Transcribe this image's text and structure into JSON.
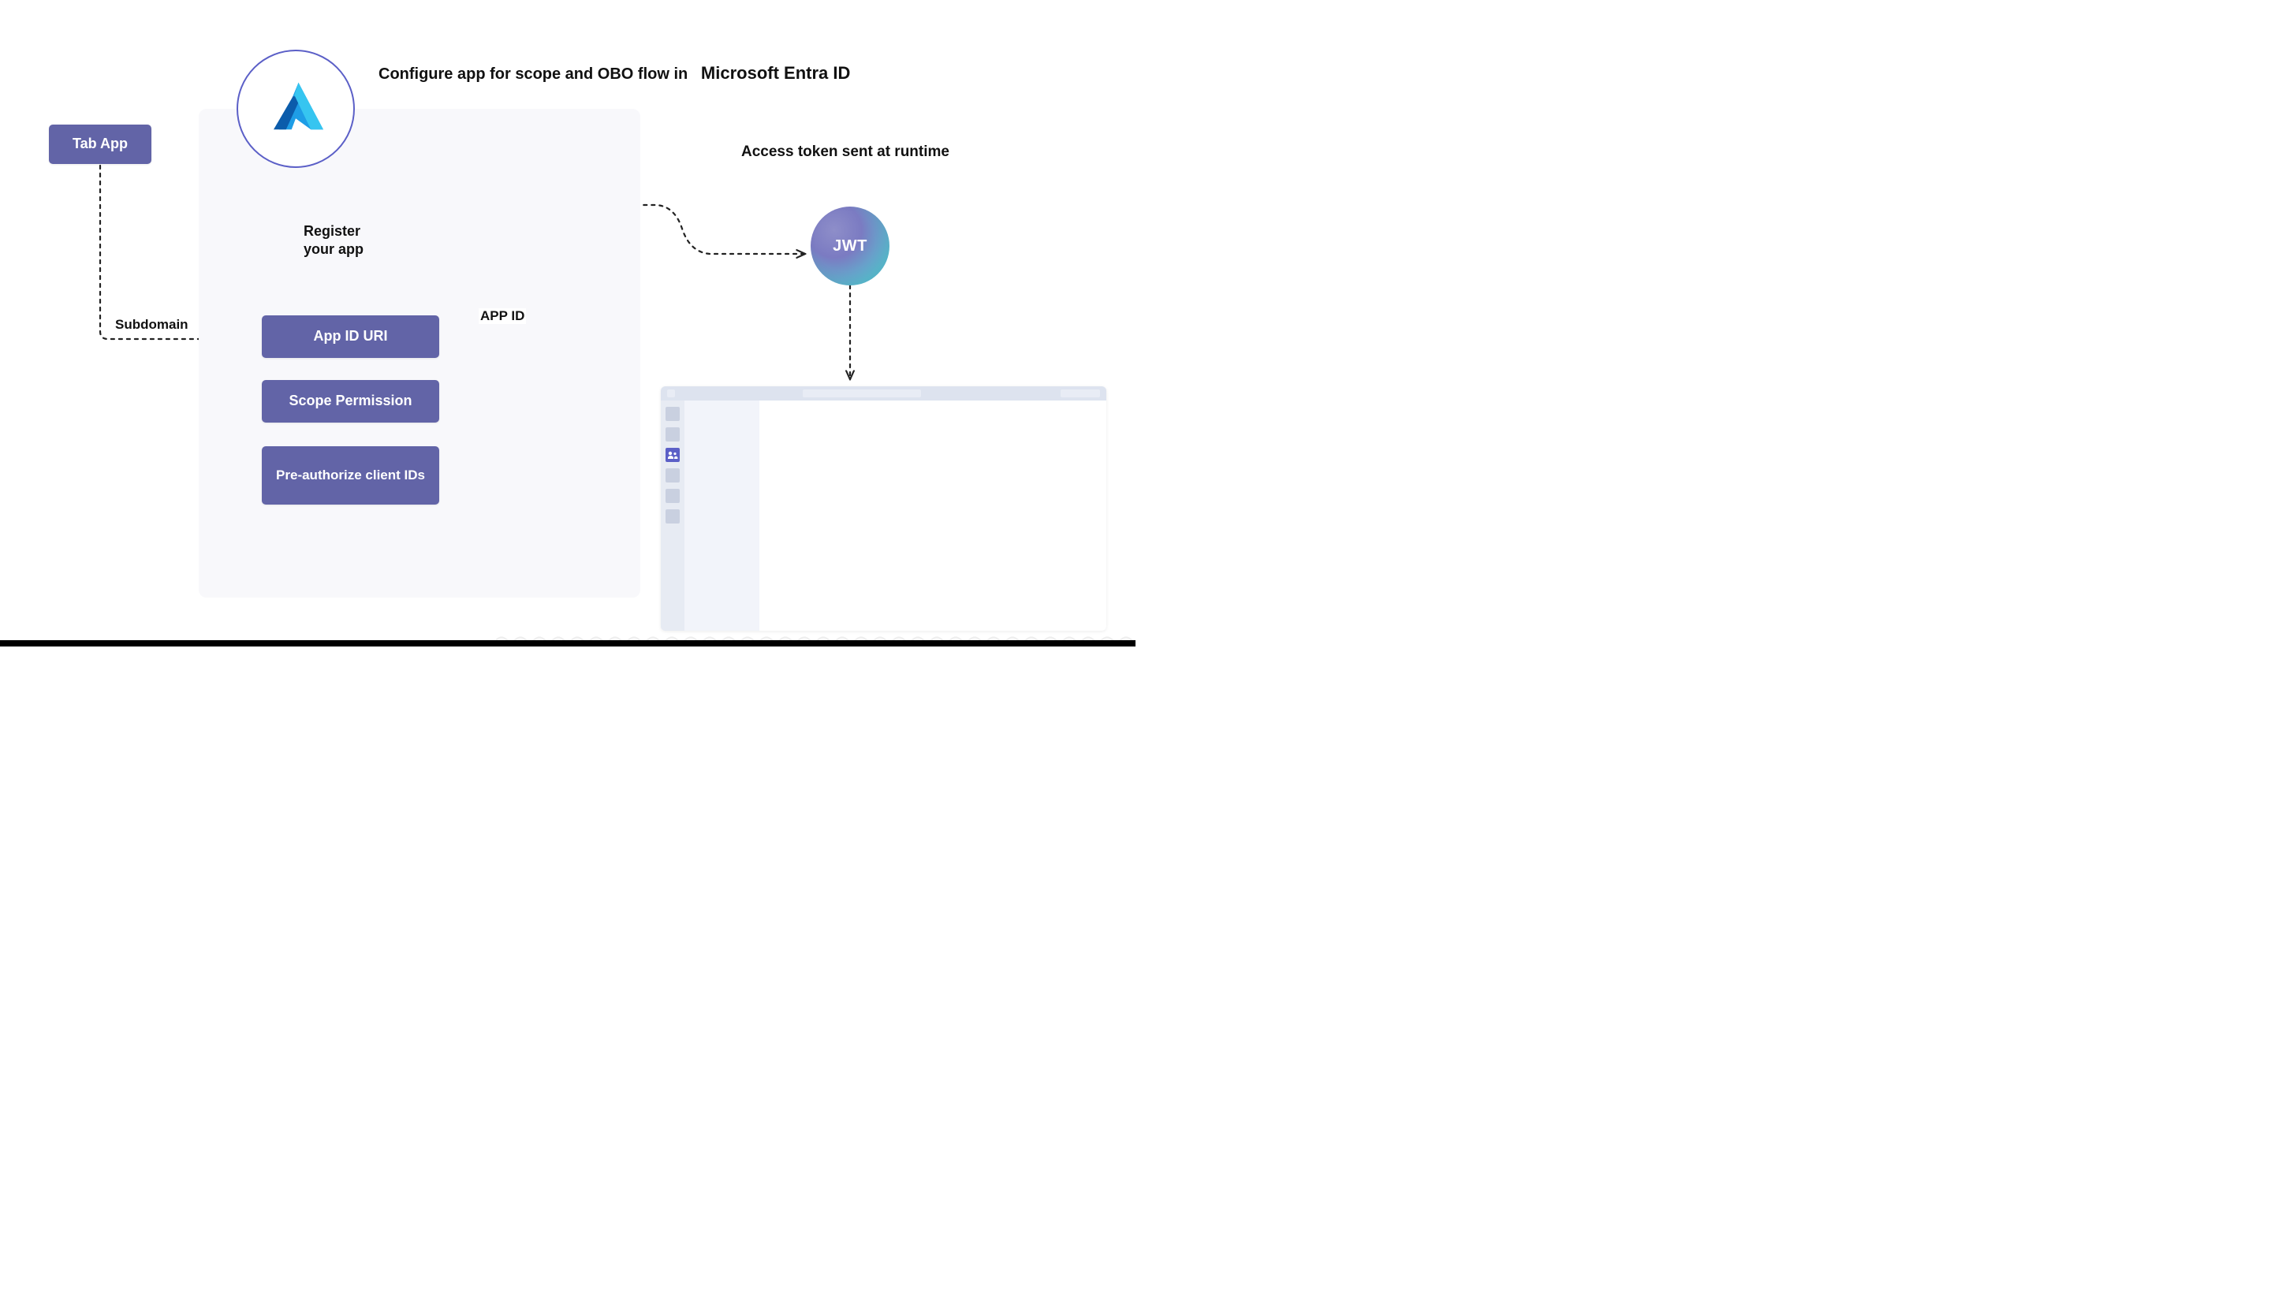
{
  "title": {
    "prefix": "Configure app for scope and OBO flow in",
    "brand": "Microsoft Entra ID"
  },
  "runtime_heading": "Access token sent at runtime",
  "tab_app_label": "Tab App",
  "register_label_line1": "Register",
  "register_label_line2": "your app",
  "steps": {
    "app_id_uri": "App ID URI",
    "scope_permission": "Scope Permission",
    "pre_authorize": "Pre-authorize client IDs"
  },
  "edge_labels": {
    "subdomain": "Subdomain",
    "app_id": "APP ID"
  },
  "jwt_label": "JWT",
  "colors": {
    "accent": "#6264a7",
    "panel": "#f8f8fb",
    "azure_stroke": "#5b5fc7"
  }
}
